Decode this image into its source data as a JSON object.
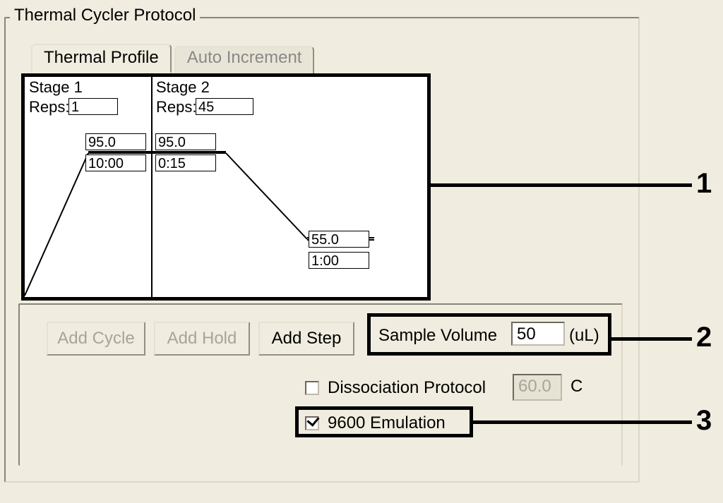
{
  "groupbox": {
    "title": "Thermal Cycler Protocol"
  },
  "tabs": {
    "thermal": "Thermal Profile",
    "auto": "Auto Increment"
  },
  "profile": {
    "stage1": {
      "title": "Stage 1",
      "reps_label": "Reps:",
      "reps_value": "1",
      "step1": {
        "temp": "95.0",
        "time": "10:00"
      }
    },
    "stage2": {
      "title": "Stage 2",
      "reps_label": "Reps:",
      "reps_value": "45",
      "step1": {
        "temp": "95.0",
        "time": "0:15"
      },
      "step2": {
        "temp": "55.0",
        "time": "1:00"
      }
    }
  },
  "buttons": {
    "add_cycle": "Add Cycle",
    "add_hold": "Add Hold",
    "add_step": "Add Step"
  },
  "sample_volume": {
    "label": "Sample Volume",
    "value": "50",
    "unit": "(uL)"
  },
  "dissociation": {
    "label": "Dissociation Protocol",
    "checked": false,
    "temp": "60.0",
    "unit": "C"
  },
  "emulation": {
    "label": "9600 Emulation",
    "checked": true
  },
  "callouts": {
    "n1": "1",
    "n2": "2",
    "n3": "3"
  }
}
